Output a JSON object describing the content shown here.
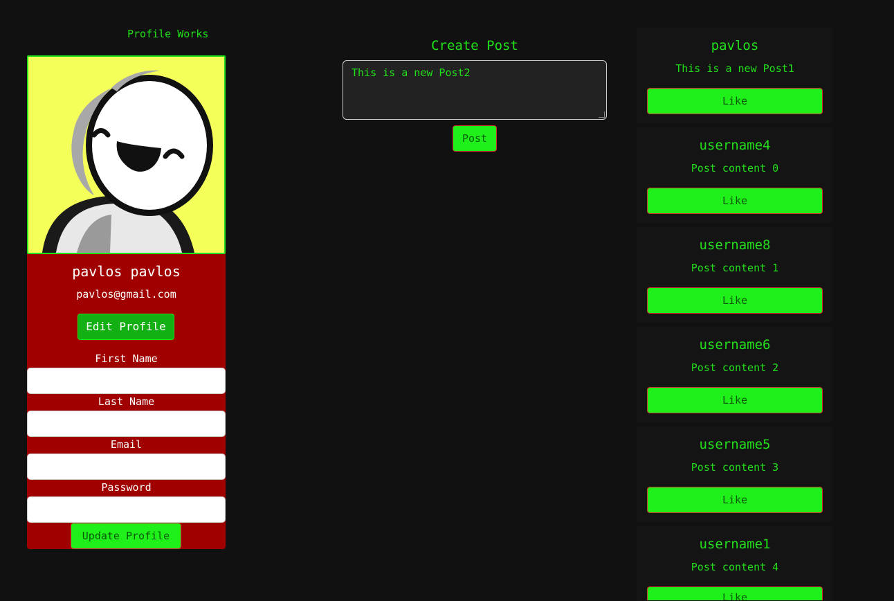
{
  "profile": {
    "heading": "Profile Works",
    "name": "pavlos pavlos",
    "email": "pavlos@gmail.com",
    "edit_label": "Edit Profile",
    "fields": [
      {
        "label": "First Name",
        "value": ""
      },
      {
        "label": "Last Name",
        "value": ""
      },
      {
        "label": "Email",
        "value": ""
      },
      {
        "label": "Password",
        "value": ""
      }
    ],
    "update_label": "Update Profile"
  },
  "create_post": {
    "title": "Create Post",
    "text": "This is a new Post2",
    "post_label": "Post"
  },
  "feed": {
    "posts": [
      {
        "user": "pavlos",
        "content": "This is a new Post1",
        "like_label": "Like"
      },
      {
        "user": "username4",
        "content": "Post content 0",
        "like_label": "Like"
      },
      {
        "user": "username8",
        "content": "Post content 1",
        "like_label": "Like"
      },
      {
        "user": "username6",
        "content": "Post content 2",
        "like_label": "Like"
      },
      {
        "user": "username5",
        "content": "Post content 3",
        "like_label": "Like"
      },
      {
        "user": "username1",
        "content": "Post content 4",
        "like_label": "Like"
      }
    ]
  },
  "colors": {
    "accent_green": "#22e01a",
    "button_green": "#1ff01a",
    "card_red": "#a00000",
    "avatar_bg": "#f4ff5a",
    "page_bg": "#111111"
  }
}
